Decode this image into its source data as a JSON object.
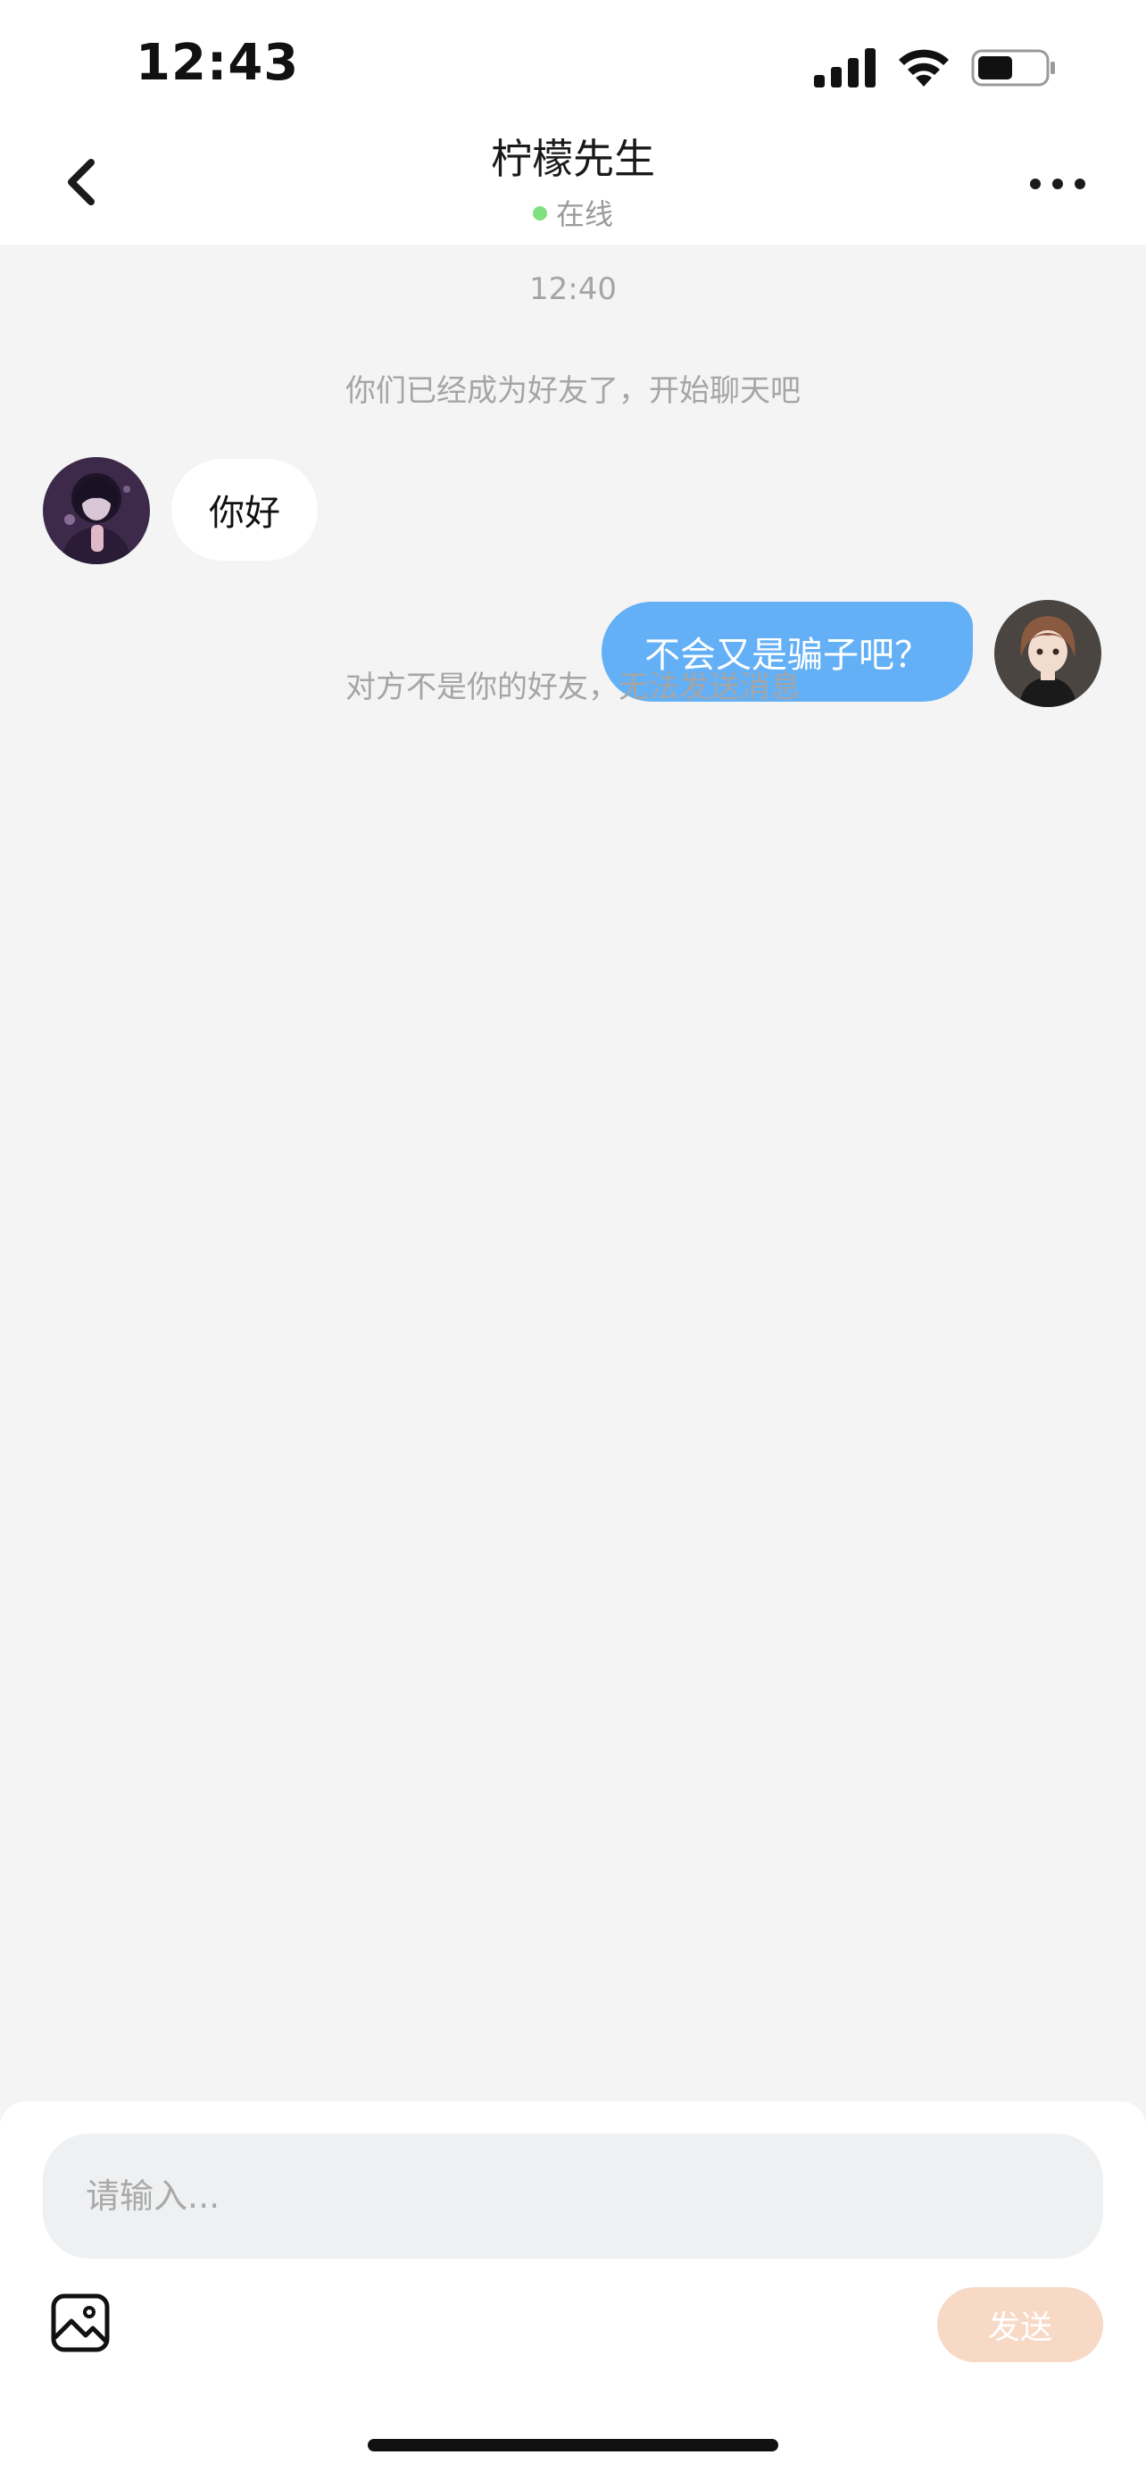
{
  "status_bar": {
    "time": "12:43",
    "icons": [
      "cellular-signal-icon",
      "wifi-icon",
      "battery-icon"
    ],
    "battery_level": 0.5
  },
  "header": {
    "title": "柠檬先生",
    "status": "在线",
    "status_color": "#7ee07e",
    "icons": [
      "back-arrow-icon",
      "more-options-icon"
    ]
  },
  "chat": {
    "time_label": "12:40",
    "system_friend_added": "你们已经成为好友了，开始聊天吧",
    "messages": [
      {
        "side": "left",
        "text": "你好"
      },
      {
        "side": "right",
        "text": "不会又是骗子吧？"
      }
    ],
    "system_not_friend": "对方不是你的好友，无法发送消息"
  },
  "composer": {
    "placeholder": "请输入...",
    "value": "",
    "send_label": "发送",
    "icons": [
      "image-icon"
    ],
    "send_color": "#f8d9c6",
    "bubble_color": "#63b0f7"
  }
}
